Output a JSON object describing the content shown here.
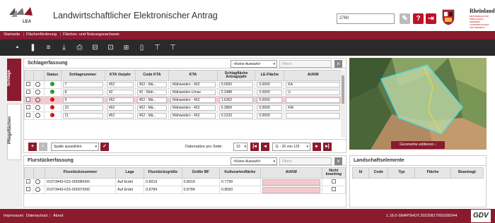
{
  "header": {
    "logo_text": "LEA",
    "title": "Landwirtschaftlicher Elektronischer Antrag",
    "id_value": "2760",
    "state_name": "Rheinland-Pfalz",
    "state_subtitle": "MINISTERIUM FÜR WIRTSCHAFT, VERKEHR, LANDWIRTSCHAFT UND WEINBAU"
  },
  "nav": {
    "items": [
      "Startseite",
      "Flächenförderung",
      "Flächen- und Nutzungsnachweis"
    ]
  },
  "left_tabs": {
    "schlaege": "Schläge",
    "pflegeflaechen": "Pflegeflächen"
  },
  "schlag": {
    "title": "Schlagerfassung",
    "select_value": "<Keine Auswahl>",
    "filter_placeholder": "Filtern",
    "columns": [
      "Status",
      "Schlagnummer",
      "KTA Vorjahr",
      "Code KTA",
      "KTA",
      "Schlagfläche Antragsjahr",
      "LE-Fläche",
      "AUKM"
    ],
    "rows": [
      {
        "status": "#2a9a2a",
        "nr": "7",
        "vorjahr": "452",
        "code": "452 - Mä...",
        "kta": "Mähweiden - 452",
        "flaeche": "0.0000",
        "le": "0.0000",
        "aukm": "KA"
      },
      {
        "status": "#2a9a2a",
        "nr": "8",
        "vorjahr": "42",
        "code": "42 - Mäh...",
        "kta": "Mähweiden Umse",
        "flaeche": "2.2488",
        "le": "0.0000",
        "aukm": "U"
      },
      {
        "status": "#dd1111",
        "nr": "9",
        "vorjahr": "452",
        "code": "452 - Mä...",
        "kta": "Mähweiden - 452",
        "flaeche": "1.6362",
        "le": "0.0000",
        "aukm": ""
      },
      {
        "status": "#dd1111",
        "nr": "10",
        "vorjahr": "452",
        "code": "452 - Mä...",
        "kta": "Mähweiden - 452",
        "flaeche": "5.3869",
        "le": "0.0000",
        "aukm": "KM"
      },
      {
        "status": "#dd1111",
        "nr": "11",
        "vorjahr": "452",
        "code": "452 - Mä...",
        "kta": "Mähweiden - 452",
        "flaeche": "0.2233",
        "le": "0.0000",
        "aukm": ""
      }
    ],
    "columns_select": "Spalte auswählen",
    "per_page_label": "Datensätze pro Seite:",
    "per_page_value": "10",
    "range": "11 - 20 von 125"
  },
  "map": {
    "button_label": "Geometrie editieren"
  },
  "flur": {
    "title": "Flurstückerfassung",
    "select_value": "<Keine Auswahl>",
    "filter_placeholder": "Filtern",
    "columns": [
      "Flurstücksnummer",
      "Lage",
      "Flurstücksgröße",
      "Größe BF",
      "Kulturartenfläche",
      "AUKM",
      "Nicht beantrag"
    ],
    "rows": [
      {
        "nr": "01073443-015-00008/000",
        "lage": "Auf Erdel",
        "groesse": "0.8019",
        "bf": "0.8019",
        "kultur": "0.7799"
      },
      {
        "nr": "01073443-015-00007/000",
        "lage": "Auf Erdel",
        "groesse": "0.8784",
        "bf": "0.8784",
        "kultur": "0.8583"
      }
    ]
  },
  "landschaft": {
    "title": "Landschaftselemente",
    "columns": [
      "Id",
      "Code",
      "Typ",
      "Fläche",
      "Beantragt"
    ]
  },
  "footer": {
    "links": [
      "Impressum",
      "Datenschutz",
      "About"
    ],
    "version": "1.16.0-SNAPSHOT.20220817091039244",
    "brand": "GDV"
  },
  "colors": {
    "brand": "#8a1a2e",
    "toolbar": "#2a2a2a",
    "green": "#2a9a2a",
    "red": "#dd1111",
    "selected_row": "#f5c8cf"
  }
}
